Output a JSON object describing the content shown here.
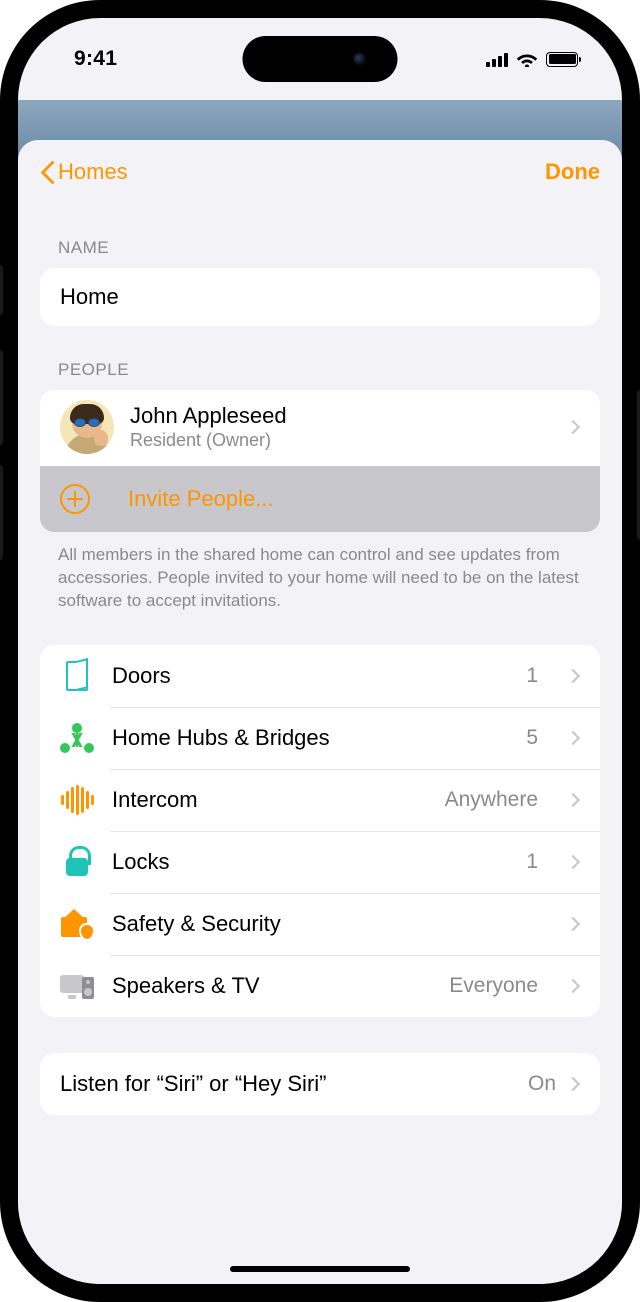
{
  "status": {
    "time": "9:41"
  },
  "nav": {
    "back": "Homes",
    "done": "Done"
  },
  "nameSection": {
    "header": "NAME",
    "value": "Home"
  },
  "peopleSection": {
    "header": "PEOPLE",
    "person": {
      "name": "John Appleseed",
      "role": "Resident (Owner)"
    },
    "invite": "Invite People...",
    "footer": "All members in the shared home can control and see updates from accessories. People invited to your home will need to be on the latest software to accept invitations."
  },
  "categories": [
    {
      "label": "Doors",
      "value": "1"
    },
    {
      "label": "Home Hubs & Bridges",
      "value": "5"
    },
    {
      "label": "Intercom",
      "value": "Anywhere"
    },
    {
      "label": "Locks",
      "value": "1"
    },
    {
      "label": "Safety & Security",
      "value": ""
    },
    {
      "label": "Speakers & TV",
      "value": "Everyone"
    }
  ],
  "siri": {
    "label": "Listen for “Siri” or “Hey Siri”",
    "value": "On"
  }
}
